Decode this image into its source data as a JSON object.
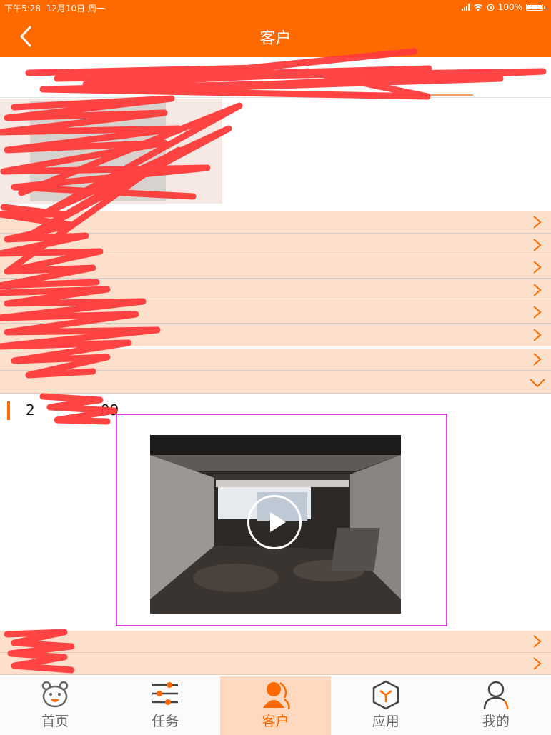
{
  "status": {
    "time": "下午5:28",
    "date": "12月10日 周一",
    "battery": "100%"
  },
  "nav": {
    "title": "客户"
  },
  "colors": {
    "brand": "#ff6a00",
    "row_bg": "#fde0cc",
    "video_border": "#e03ee0",
    "redaction": "#ff3b3b"
  },
  "section": {
    "date_prefix": "2",
    "date_suffix": "09"
  },
  "video": {
    "icon": "play-icon"
  },
  "rows": {
    "collapsed_count": 7,
    "expanded_count": 1,
    "bottom_count": 2
  },
  "tabs": [
    {
      "label": "首页",
      "icon": "home-bear-icon",
      "active": false
    },
    {
      "label": "任务",
      "icon": "sliders-icon",
      "active": false
    },
    {
      "label": "客户",
      "icon": "customers-icon",
      "active": true
    },
    {
      "label": "应用",
      "icon": "cube-icon",
      "active": false
    },
    {
      "label": "我的",
      "icon": "profile-icon",
      "active": false
    }
  ]
}
